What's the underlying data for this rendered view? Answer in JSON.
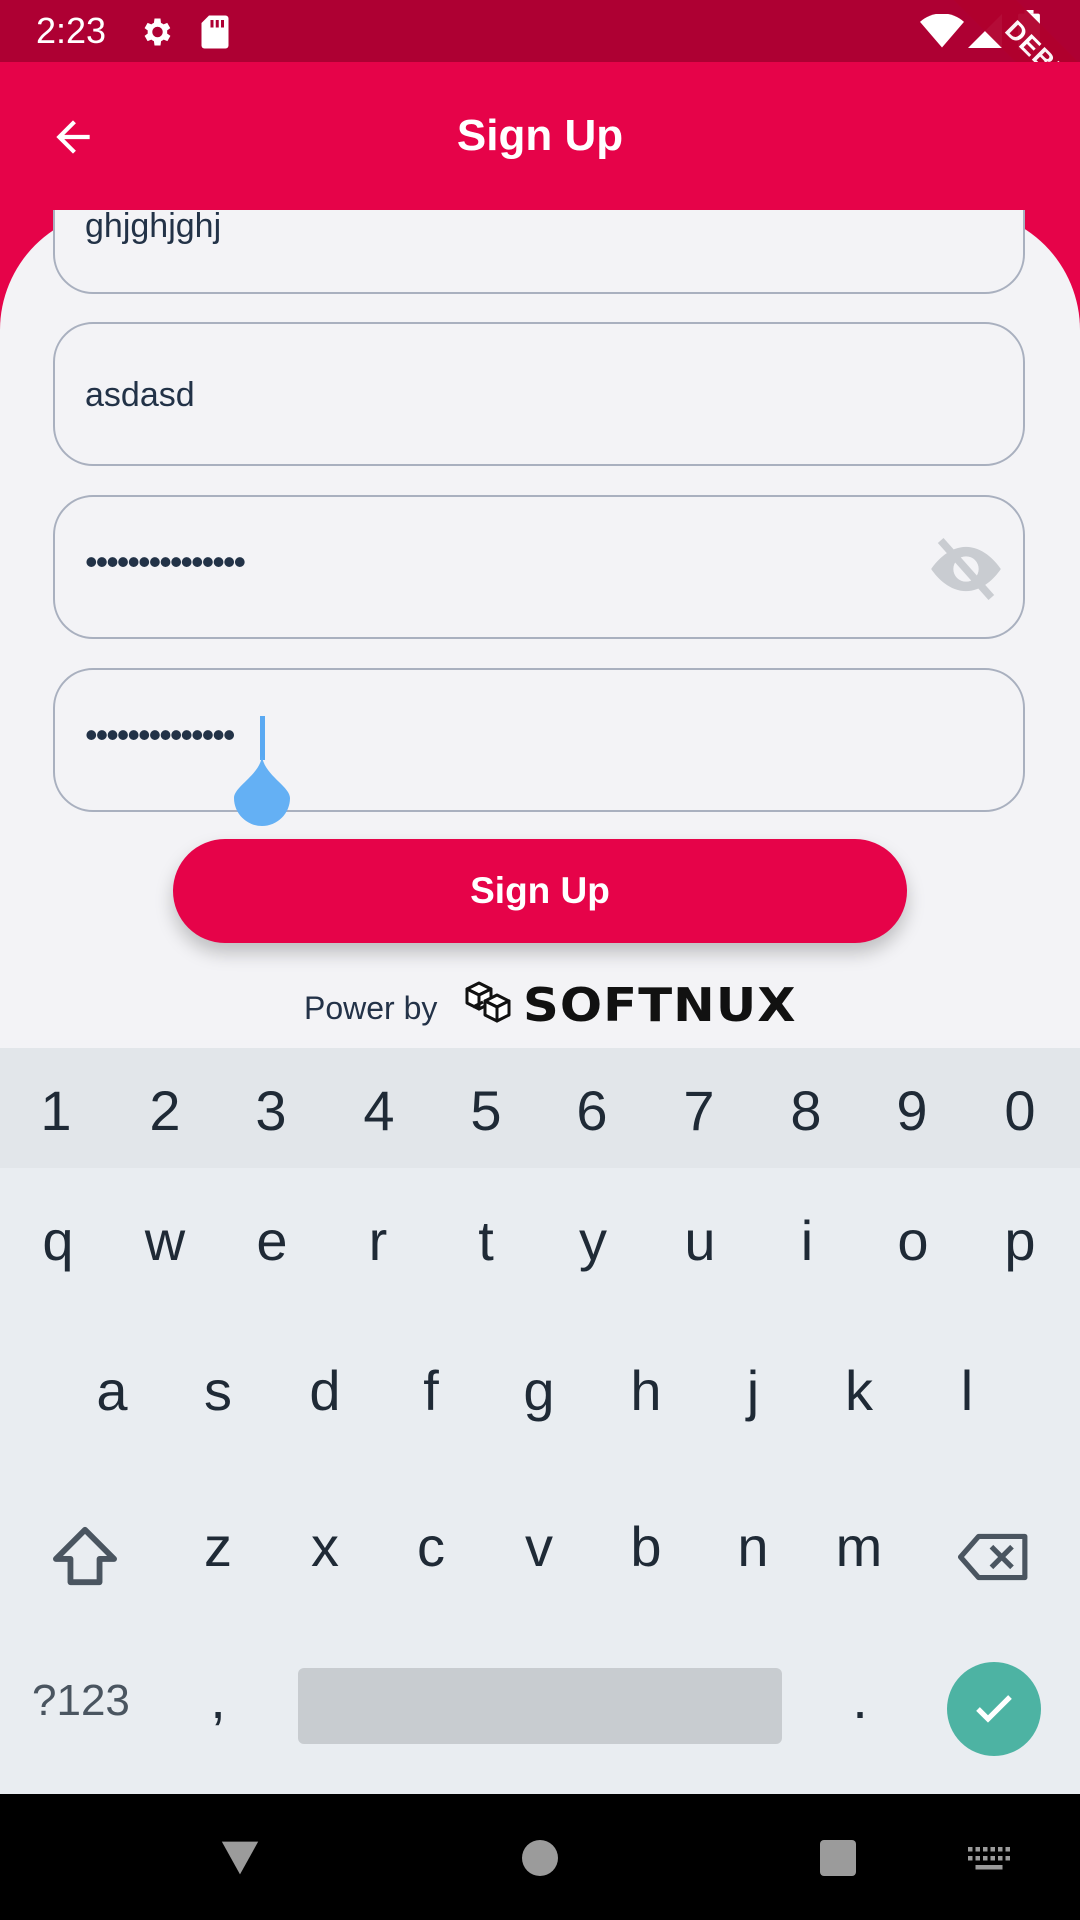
{
  "status_bar": {
    "time": "2:23",
    "icons": [
      "settings-icon",
      "sd-card-icon",
      "wifi-icon",
      "signal-icon",
      "battery-icon"
    ],
    "debug_label": "DEBUG"
  },
  "app_bar": {
    "title": "Sign Up",
    "back_icon": "arrow-back-icon"
  },
  "form": {
    "fields": [
      {
        "name": "field-1",
        "value": "ghjghjghj"
      },
      {
        "name": "field-2",
        "value": "asdasd"
      },
      {
        "name": "password",
        "value": "•••••••••••••••",
        "toggle_icon": "visibility-off-icon"
      },
      {
        "name": "confirm-password",
        "value": "••••••••••••••"
      }
    ],
    "submit_label": "Sign Up",
    "power_by": "Power by",
    "brand": "SOFTNUX"
  },
  "keyboard": {
    "number_row": [
      "1",
      "2",
      "3",
      "4",
      "5",
      "6",
      "7",
      "8",
      "9",
      "0"
    ],
    "row1": [
      "q",
      "w",
      "e",
      "r",
      "t",
      "y",
      "u",
      "i",
      "o",
      "p"
    ],
    "row2": [
      "a",
      "s",
      "d",
      "f",
      "g",
      "h",
      "j",
      "k",
      "l"
    ],
    "row3": [
      "z",
      "x",
      "c",
      "v",
      "b",
      "n",
      "m"
    ],
    "symbols_label": "?123",
    "comma": ",",
    "period": "."
  },
  "colors": {
    "primary": "#e60349",
    "status_bar": "#ae0033",
    "accent_done": "#4db3a3",
    "cursor": "#5aa9f2"
  }
}
